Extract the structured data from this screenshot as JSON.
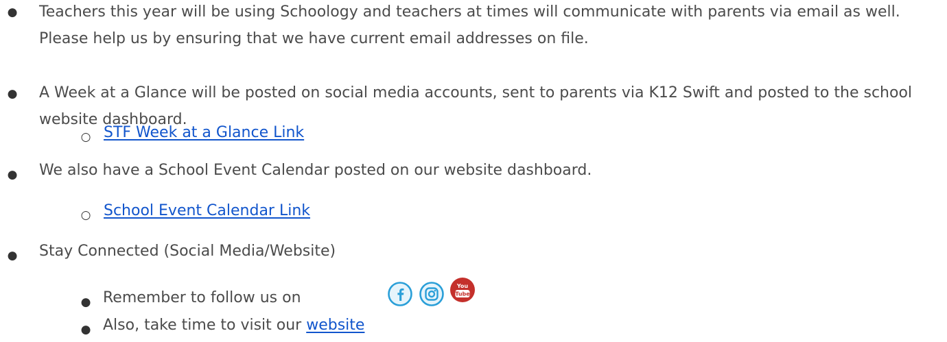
{
  "bullets": {
    "item1": "Teachers this year will be using Schoology and teachers at times will communicate with parents via email as well. Please help us by ensuring that we have current email addresses on file.",
    "item2": "A Week at a Glance will be posted on social media accounts, sent to parents via K12 Swift and posted to the school website dashboard.",
    "item2_link": "STF Week at a Glance Link",
    "item3": "We also have a School Event Calendar posted on our website dashboard.",
    "item3_link": "School Event Calendar Link",
    "item4": "Stay Connected (Social Media/Website)",
    "item4_sub1": "Remember to follow us on",
    "item4_sub2_prefix": "Also, take time to visit our ",
    "item4_sub2_link": "website"
  },
  "markers": {
    "filled": "●",
    "hollow": "○"
  },
  "icons": [
    "facebook-icon",
    "instagram-icon",
    "youtube-icon"
  ],
  "colors": {
    "text": "#4b4b4b",
    "link": "#1155cc",
    "social_blue": "#2a9fd8",
    "youtube_red": "#c4302b"
  }
}
